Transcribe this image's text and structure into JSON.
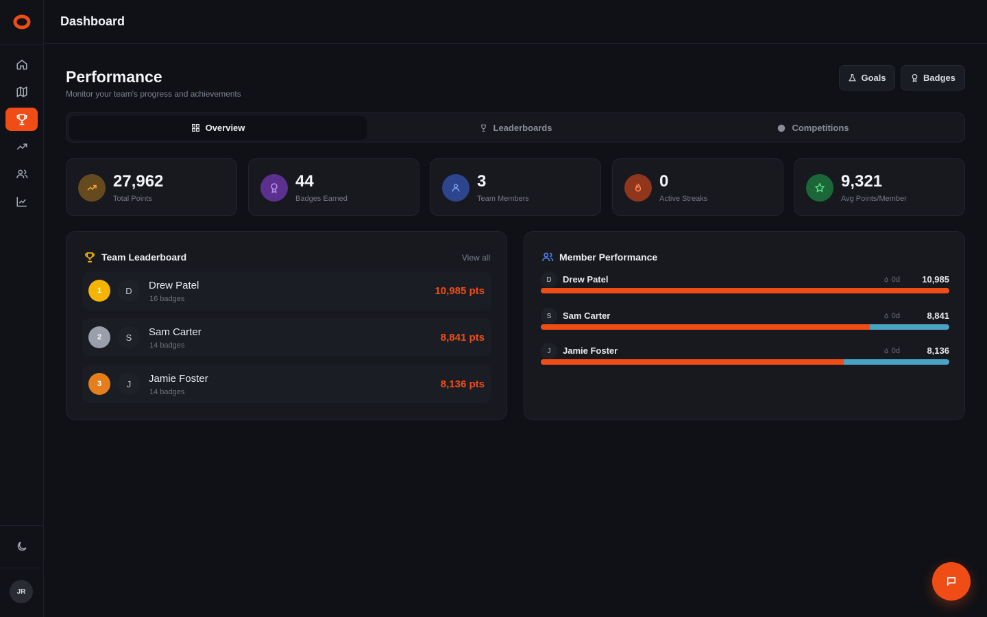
{
  "header": {
    "title": "Dashboard"
  },
  "sidebar": {
    "items": [
      {
        "icon": "home-icon"
      },
      {
        "icon": "map-icon"
      },
      {
        "icon": "trophy-icon",
        "active": true
      },
      {
        "icon": "trending-up-icon"
      },
      {
        "icon": "users-icon"
      },
      {
        "icon": "chart-icon"
      }
    ],
    "theme_icon": "moon-icon",
    "avatar": "JR"
  },
  "page": {
    "title": "Performance",
    "subtitle": "Monitor your team's progress and achievements",
    "actions": {
      "goals": "Goals",
      "badges": "Badges"
    }
  },
  "tabs": [
    {
      "label": "Overview",
      "active": true
    },
    {
      "label": "Leaderboards"
    },
    {
      "label": "Competitions"
    }
  ],
  "stats": [
    {
      "value": "27,962",
      "label": "Total Points",
      "color": "#f5a623"
    },
    {
      "value": "44",
      "label": "Badges Earned",
      "color": "#8b3fd9"
    },
    {
      "value": "3",
      "label": "Team Members",
      "color": "#3b63d6"
    },
    {
      "value": "0",
      "label": "Active Streaks",
      "color": "#e0491a"
    },
    {
      "value": "9,321",
      "label": "Avg Points/Member",
      "color": "#1fa84a"
    }
  ],
  "leaderboard": {
    "title": "Team Leaderboard",
    "view_all": "View all",
    "rows": [
      {
        "rank": "1",
        "initial": "D",
        "name": "Drew Patel",
        "badges": "16 badges",
        "points": "10,985 pts",
        "rank_color": "#f5b400"
      },
      {
        "rank": "2",
        "initial": "S",
        "name": "Sam Carter",
        "badges": "14 badges",
        "points": "8,841 pts",
        "rank_color": "#9aa0ab"
      },
      {
        "rank": "3",
        "initial": "J",
        "name": "Jamie Foster",
        "badges": "14 badges",
        "points": "8,136 pts",
        "rank_color": "#e67e1c"
      }
    ]
  },
  "member_performance": {
    "title": "Member Performance",
    "rows": [
      {
        "initial": "D",
        "name": "Drew Patel",
        "streak": "0d",
        "value": "10,985",
        "progress": 1.0
      },
      {
        "initial": "S",
        "name": "Sam Carter",
        "streak": "0d",
        "value": "8,841",
        "progress": 0.805
      },
      {
        "initial": "J",
        "name": "Jamie Foster",
        "streak": "0d",
        "value": "8,136",
        "progress": 0.741
      }
    ]
  },
  "colors": {
    "accent": "#f04d16",
    "bar_remainder": "#4aa2c4"
  }
}
